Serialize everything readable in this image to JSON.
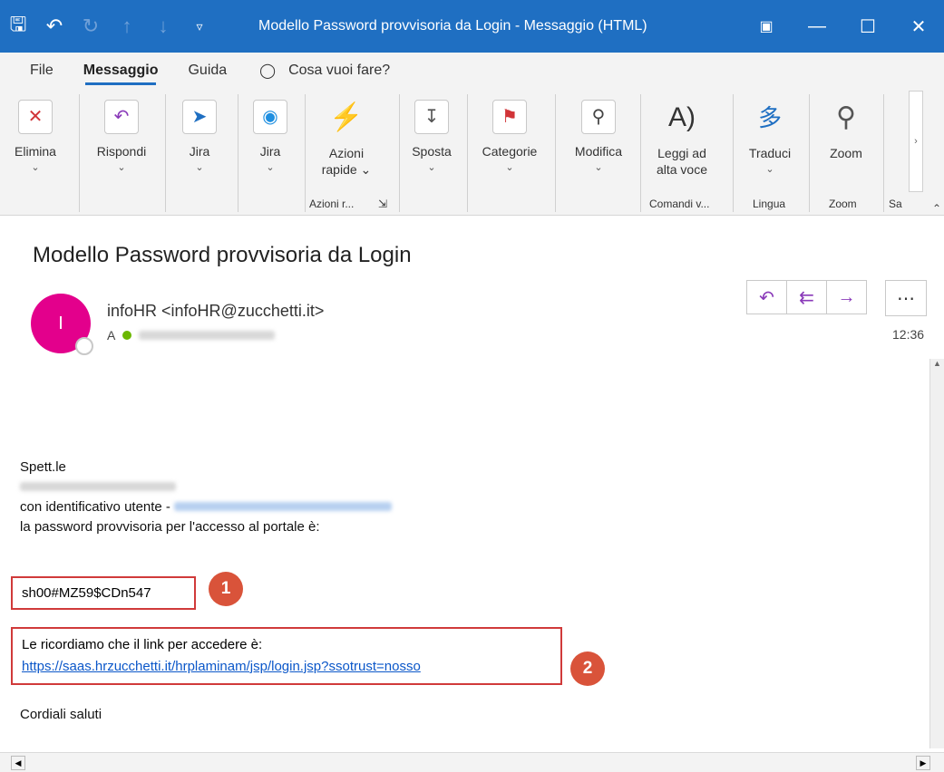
{
  "window": {
    "title": "Modello Password provvisoria da Login  -  Messaggio (HTML)",
    "icons": [
      "save-icon",
      "undo-icon",
      "redo-icon",
      "up-icon",
      "down-icon",
      "customize-icon"
    ]
  },
  "menu": {
    "items": [
      "File",
      "Messaggio",
      "Guida"
    ],
    "tell_me": "Cosa vuoi fare?"
  },
  "ribbon": {
    "buttons": [
      {
        "label": "Elimina",
        "icon": "delete-icon"
      },
      {
        "label": "Rispondi",
        "icon": "reply-icon"
      },
      {
        "label": "Jira",
        "icon": "jira-icon"
      },
      {
        "label": "Jira",
        "icon": "jira-circle-icon"
      },
      {
        "label": "Azioni",
        "label2": "rapide",
        "icon": "lightning-icon"
      },
      {
        "label": "Sposta",
        "icon": "move-icon"
      },
      {
        "label": "Categorie",
        "icon": "flag-icon"
      },
      {
        "label": "Modifica",
        "icon": "search-icon"
      },
      {
        "label": "Leggi ad",
        "label2": "alta voce",
        "icon": "read-aloud-icon"
      },
      {
        "label": "Traduci",
        "icon": "translate-icon"
      },
      {
        "label": "Zoom",
        "icon": "zoom-icon"
      }
    ],
    "groups": [
      "Azioni r...",
      "Comandi v...",
      "Lingua",
      "Zoom",
      "Sa"
    ]
  },
  "message": {
    "subject": "Modello Password provvisoria da Login",
    "avatar_initial": "I",
    "sender": "infoHR <infoHR@zucchetti.it>",
    "to_prefix": "A",
    "time": "12:36"
  },
  "body": {
    "line1": "Spett.le",
    "line3_prefix": "con identificativo utente -",
    "line4": "la password provvisoria per l'accesso al portale è:",
    "password": "sh00#MZ59$CDn547",
    "link_intro": "Le ricordiamo che il link per accedere è:",
    "link": "https://saas.hrzucchetti.it/hrplaminam/jsp/login.jsp?ssotrust=nosso",
    "closing": "Cordiali saluti"
  },
  "annotations": [
    "1",
    "2"
  ],
  "colors": {
    "titlebar": "#1f6fc2",
    "avatar": "#e3008c",
    "badge": "#d9533a",
    "highlight_box": "#d03a3a",
    "link": "#0b57c9"
  }
}
